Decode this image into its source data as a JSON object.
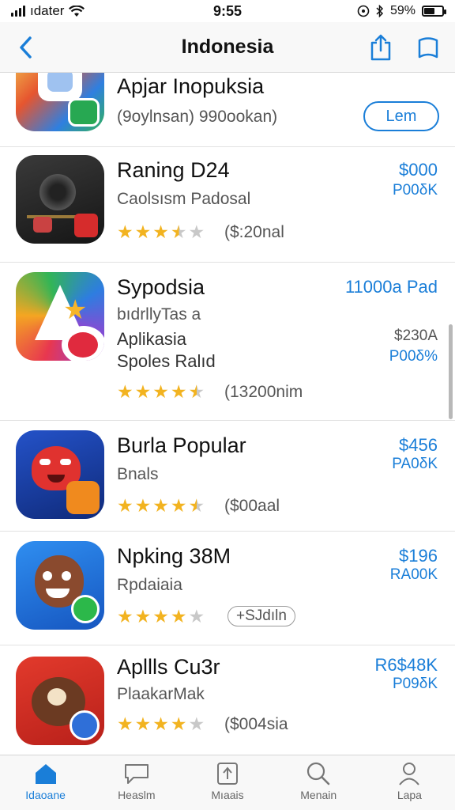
{
  "status_bar": {
    "carrier": "ıdater",
    "time": "9:55",
    "battery": "59%",
    "battery_level": 0.59
  },
  "nav": {
    "title": "Indonesia"
  },
  "apps": [
    {
      "name": "Apjar Inopuksia",
      "subtitle": "(9oylnsan)   990ookan)",
      "button": "Lem"
    },
    {
      "name": "Raning D24",
      "subtitle": "Caolsısm Padosal",
      "rating": 3.5,
      "count": "($:20nal",
      "price": "$000",
      "price_sub": "P00δK"
    },
    {
      "name": "Sypodsia",
      "subtitle": "bıdrllyTas  a",
      "subtitle2": "Aplikasia",
      "subtitle3": "Spoles Ralıd",
      "rating": 4.5,
      "count": "(13200nim",
      "price": "11000a Pad",
      "price_2": "$230A",
      "price_sub": "P00δ%"
    },
    {
      "name": "Burla Popular",
      "subtitle": "Bnals",
      "rating": 4.5,
      "count": "($00aal",
      "price": "$456",
      "price_sub": "PA0δK"
    },
    {
      "name": "Npking 38M",
      "subtitle": "Rpdaiaia",
      "rating": 4,
      "count": "+SJdıln",
      "price": "$196",
      "price_sub": "RA00K"
    },
    {
      "name": "Apllls Cu3r",
      "subtitle": "PlaakarMak",
      "rating": 4,
      "count": "($004sia",
      "price": "R6$48K",
      "price_sub": "P09δK"
    }
  ],
  "tabs": [
    {
      "label": "Idaoane",
      "icon": "home-icon",
      "active": true
    },
    {
      "label": "Heaslm",
      "icon": "chat-icon",
      "active": false
    },
    {
      "label": "Mıaais",
      "icon": "apps-icon",
      "active": false
    },
    {
      "label": "Menain",
      "icon": "search-icon",
      "active": false
    },
    {
      "label": "Lapa",
      "icon": "person-icon",
      "active": false
    }
  ],
  "colors": {
    "accent": "#1a7ed8",
    "star": "#f2b320"
  }
}
